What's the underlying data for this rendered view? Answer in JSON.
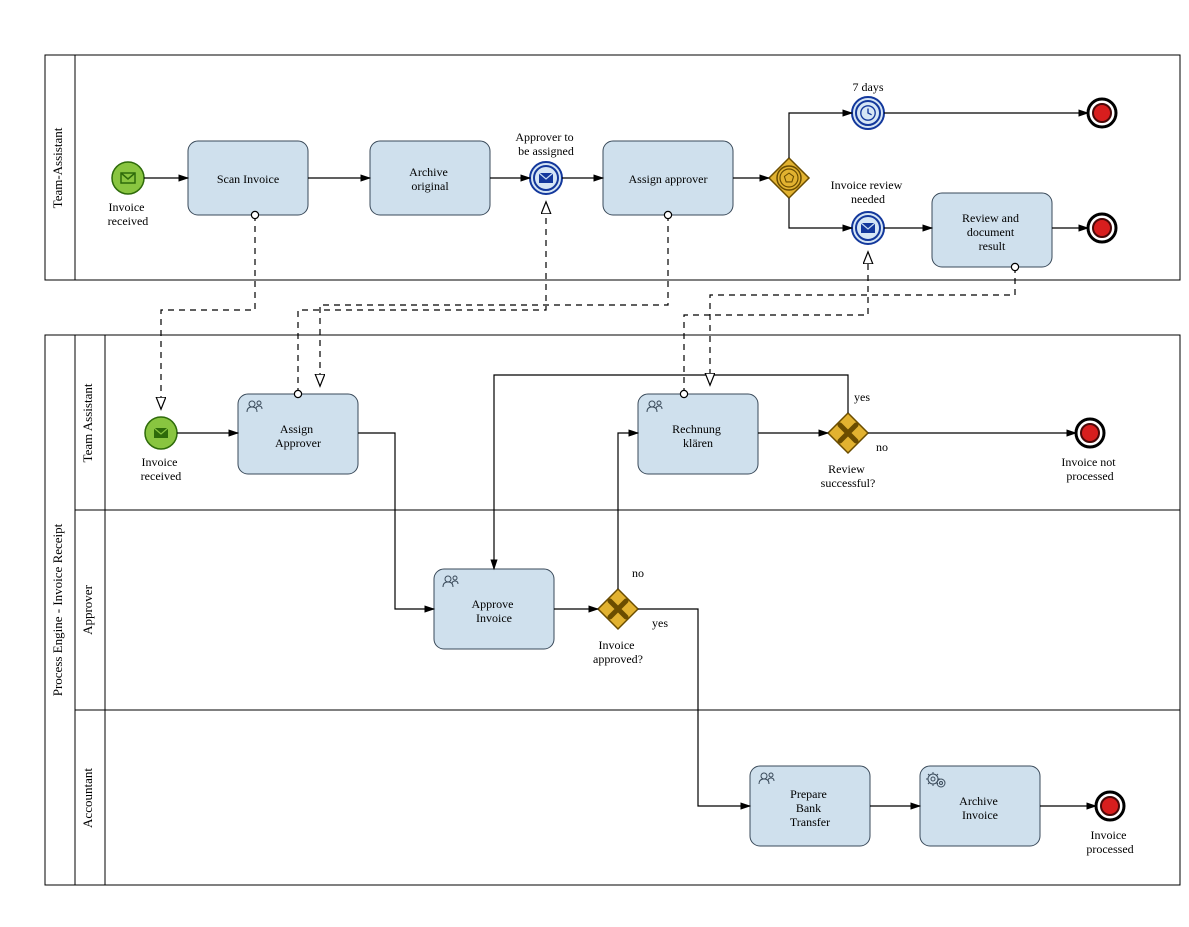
{
  "pools": {
    "top": {
      "label": "Team-Assistant",
      "events": {
        "start": "Invoice\nreceived",
        "approverAssign": "Approver to\nbe assigned",
        "timer": "7 days",
        "reviewNeeded": "Invoice review\nneeded"
      },
      "tasks": {
        "scan": "Scan Invoice",
        "archiveOrig": "Archive\noriginal",
        "assignApprover": "Assign approver",
        "reviewDoc": "Review and\ndocument\nresult"
      }
    },
    "bottom": {
      "label": "Process Engine - Invoice Receipt",
      "lanes": {
        "teamAssistant": "Team Assistant",
        "approver": "Approver",
        "accountant": "Accountant"
      },
      "events": {
        "start": "Invoice\nreceived",
        "endNotProc": "Invoice not\nprocessed",
        "endProc": "Invoice\nprocessed"
      },
      "tasks": {
        "assignApprover": "Assign\nApprover",
        "clarify": "Rechnung\nklären",
        "approveInvoice": "Approve\nInvoice",
        "prepareBank": "Prepare\nBank\nTransfer",
        "archiveInvoice": "Archive\nInvoice"
      },
      "gateways": {
        "reviewSuccessful": "Review\nsuccessful?",
        "invoiceApproved": "Invoice\napproved?"
      },
      "labels": {
        "yes": "yes",
        "no": "no"
      }
    }
  }
}
